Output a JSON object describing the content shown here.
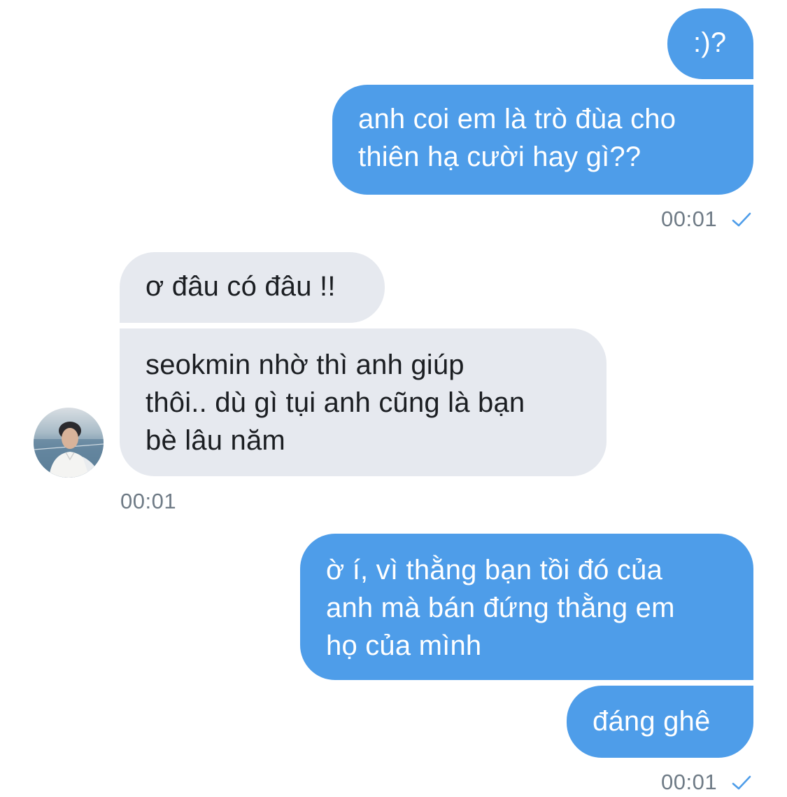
{
  "conversation": {
    "messages": [
      {
        "direction": "sent",
        "text": ":)?"
      },
      {
        "direction": "sent",
        "text": "anh coi em là trò đùa cho\nthiên hạ cười hay gì??"
      },
      {
        "direction": "received",
        "text": "ơ đâu có đâu !!"
      },
      {
        "direction": "received",
        "text": "seokmin nhờ thì anh giúp\nthôi.. dù gì tụi anh cũng là bạn\nbè lâu năm"
      },
      {
        "direction": "sent",
        "text": "ờ í, vì thằng bạn tồi đó của\nanh mà bán đứng thằng em\nhọ của mình"
      },
      {
        "direction": "sent",
        "text": "đáng ghê"
      }
    ],
    "timestamps": [
      "00:01",
      "00:01",
      "00:01"
    ],
    "sender_avatar": {
      "description": "avatar"
    }
  },
  "colors": {
    "sent_bubble": "#4e9de9",
    "received_bubble": "#e6e9ef",
    "timestamp": "#6f7b86",
    "read_check": "#4e9de9"
  }
}
